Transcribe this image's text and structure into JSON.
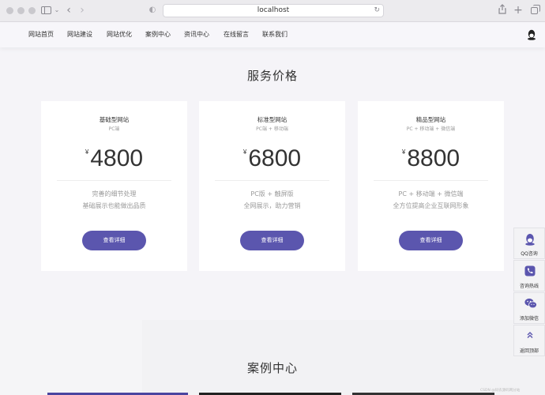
{
  "browser": {
    "url": "localhost"
  },
  "nav": {
    "items": [
      "网站首页",
      "网站建设",
      "网站优化",
      "案例中心",
      "资讯中心",
      "在线留言",
      "联系我们"
    ]
  },
  "pricing": {
    "title": "服务价格",
    "currency": "¥",
    "button_label": "查看详细",
    "cards": [
      {
        "name": "基础型网站",
        "sub": "PC端",
        "price": "4800",
        "desc1": "完善的细节处理",
        "desc2": "基础展示也能做出品质"
      },
      {
        "name": "标准型网站",
        "sub": "PC端 + 移动端",
        "price": "6800",
        "desc1": "PC版 + 触屏版",
        "desc2": "全网展示，助力营销"
      },
      {
        "name": "精品型网站",
        "sub": "PC + 移动端 + 微信端",
        "price": "8800",
        "desc1": "PC + 移动端 + 微信端",
        "desc2": "全方位提高企业互联网形象"
      }
    ]
  },
  "cases": {
    "title": "案例中心"
  },
  "float_bar": {
    "items": [
      "QQ咨询",
      "咨询热线",
      "添加微信",
      "返回顶部"
    ]
  },
  "watermark": "CSDN @码农源码网分站",
  "colors": {
    "accent": "#5b56ae",
    "page_bg": "#f5f4f8",
    "card_bg": "#ffffff"
  },
  "icons": {
    "nav_right": "qq-penguin-icon",
    "float": [
      "qq-penguin-icon",
      "phone-icon",
      "wechat-icon",
      "double-chevron-up-icon"
    ]
  }
}
